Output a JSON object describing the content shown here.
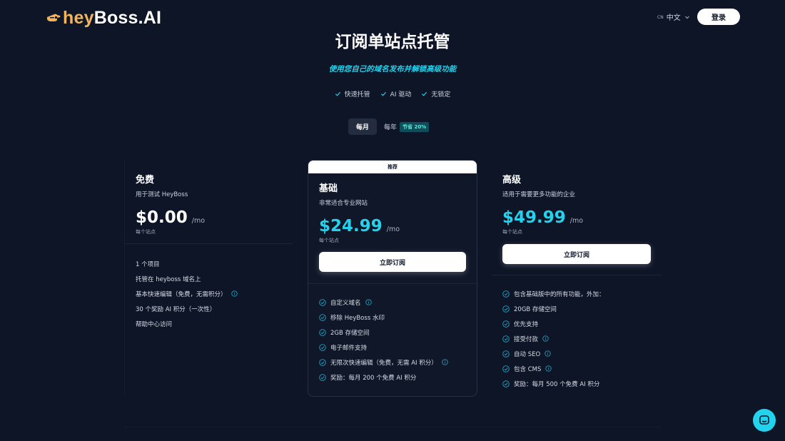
{
  "header": {
    "logo_part1": "hey",
    "logo_part2": "Boss.AI",
    "lang_code": "CN",
    "lang_label": "中文",
    "login_label": "登录"
  },
  "hero": {
    "title": "订阅单站点托管",
    "subtitle": "使用您自己的域名发布并解锁高级功能",
    "features": [
      "快速托管",
      "AI 驱动",
      "无锁定"
    ]
  },
  "billing_toggle": {
    "monthly": "每月",
    "yearly": "每年",
    "yearly_badge": "节省 20%",
    "selected": "每月"
  },
  "plans": [
    {
      "name": "免费",
      "desc": "用于测试 HeyBoss",
      "price": "$0.00",
      "per": "/mo",
      "per_site": "每个站点",
      "features": [
        "1 个项目",
        "托管在 heyboss 域名上",
        "基本快速编辑（免费，无需积分）",
        "30 个奖励 AI 积分（一次性）",
        "帮助中心访问"
      ]
    },
    {
      "badge": "推荐",
      "name": "基础",
      "desc": "非常适合专业网站",
      "price": "$24.99",
      "per": "/mo",
      "per_site": "每个站点",
      "button": "立即订阅",
      "features": [
        "自定义域名",
        "移除 HeyBoss 水印",
        "2GB 存储空间",
        "电子邮件支持",
        "无限次快速编辑（免费，无需 AI 积分）",
        "奖励：每月 200 个免费 AI 积分"
      ]
    },
    {
      "name": "高级",
      "desc": "适用于需要更多功能的企业",
      "price": "$49.99",
      "per": "/mo",
      "per_site": "每个站点",
      "button": "立即订阅",
      "features": [
        "包含基础版中的所有功能，外加：",
        "20GB 存储空间",
        "优先支持",
        "接受付款",
        "自动 SEO",
        "包含 CMS",
        "奖励：每月 500 个免费 AI 积分"
      ]
    }
  ],
  "colors": {
    "background": "#0e1527",
    "accent": "#22d3ee",
    "brand_orange": "#f1b45c"
  },
  "icons": {
    "check": "check-icon",
    "check_circle": "check-circle-icon",
    "info": "info-icon",
    "chat": "chat-icon"
  }
}
